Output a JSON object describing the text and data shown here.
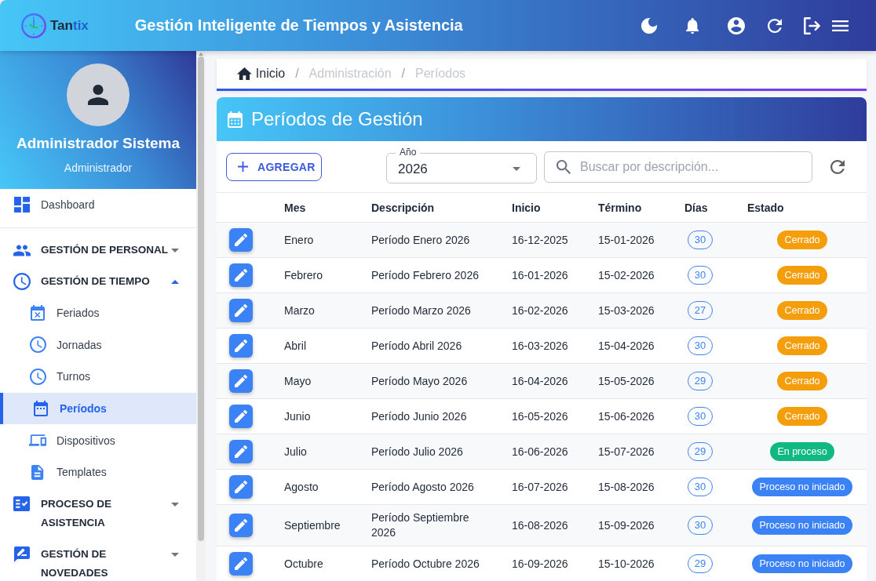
{
  "header": {
    "logo": {
      "lead": "Tan",
      "accent": "tix"
    },
    "title": "Gestión Inteligente de Tiempos y Asistencia"
  },
  "sidebar": {
    "user": {
      "name": "Administrador Sistema",
      "role": "Administrador"
    },
    "items": [
      {
        "kind": "link",
        "label": "Dashboard",
        "selected": false
      },
      {
        "kind": "group",
        "label": "GESTIÓN DE PERSONAL",
        "selected": false,
        "expanded": false
      },
      {
        "kind": "group",
        "label": "GESTIÓN DE TIEMPO",
        "selected": false,
        "expanded": true,
        "children": [
          {
            "label": "Feriados",
            "selected": false
          },
          {
            "label": "Jornadas",
            "selected": false
          },
          {
            "label": "Turnos",
            "selected": false
          },
          {
            "label": "Períodos",
            "selected": true
          },
          {
            "label": "Dispositivos",
            "selected": false
          },
          {
            "label": "Templates",
            "selected": false
          }
        ]
      },
      {
        "kind": "group",
        "label": "PROCESO DE ASISTENCIA",
        "selected": false,
        "expanded": false
      },
      {
        "kind": "group",
        "label": "GESTIÓN DE NOVEDADES",
        "selected": false,
        "expanded": false
      }
    ]
  },
  "breadcrumb": [
    {
      "label": "Inicio",
      "disabled": false
    },
    {
      "separator": "/",
      "label": "Administración",
      "disabled": true
    },
    {
      "separator": "/",
      "label": "Períodos",
      "disabled": true
    }
  ],
  "panel": {
    "title": "Períodos de Gestión",
    "add_button": "AGREGAR",
    "year_field": {
      "label": "Año",
      "value": "2026"
    },
    "search": {
      "placeholder": "Buscar por descripción..."
    },
    "table": {
      "columns": [
        "Mes",
        "Descripción",
        "Inicio",
        "Término",
        "Días",
        "Estado"
      ],
      "rows": [
        {
          "mes": "Enero",
          "descripcion": "Período Enero 2026",
          "inicio": "16-12-2025",
          "termino": "15-01-2026",
          "dias": "30",
          "estado": "Cerrado",
          "color": "#f59e0b"
        },
        {
          "mes": "Febrero",
          "descripcion": "Período Febrero 2026",
          "inicio": "16-01-2026",
          "termino": "15-02-2026",
          "dias": "30",
          "estado": "Cerrado",
          "color": "#f59e0b"
        },
        {
          "mes": "Marzo",
          "descripcion": "Período Marzo 2026",
          "inicio": "16-02-2026",
          "termino": "15-03-2026",
          "dias": "27",
          "estado": "Cerrado",
          "color": "#f59e0b"
        },
        {
          "mes": "Abril",
          "descripcion": "Período Abril 2026",
          "inicio": "16-03-2026",
          "termino": "15-04-2026",
          "dias": "30",
          "estado": "Cerrado",
          "color": "#f59e0b"
        },
        {
          "mes": "Mayo",
          "descripcion": "Período Mayo 2026",
          "inicio": "16-04-2026",
          "termino": "15-05-2026",
          "dias": "29",
          "estado": "Cerrado",
          "color": "#f59e0b"
        },
        {
          "mes": "Junio",
          "descripcion": "Período Junio 2026",
          "inicio": "16-05-2026",
          "termino": "15-06-2026",
          "dias": "30",
          "estado": "Cerrado",
          "color": "#f59e0b"
        },
        {
          "mes": "Julio",
          "descripcion": "Período Julio 2026",
          "inicio": "16-06-2026",
          "termino": "15-07-2026",
          "dias": "29",
          "estado": "En proceso",
          "color": "#10b981"
        },
        {
          "mes": "Agosto",
          "descripcion": "Período Agosto 2026",
          "inicio": "16-07-2026",
          "termino": "15-08-2026",
          "dias": "30",
          "estado": "Proceso no iniciado",
          "color": "#3b82f6"
        },
        {
          "mes": "Septiembre",
          "descripcion": "Período Septiembre 2026",
          "inicio": "16-08-2026",
          "termino": "15-09-2026",
          "dias": "30",
          "estado": "Proceso no iniciado",
          "color": "#3b82f6"
        },
        {
          "mes": "Octubre",
          "descripcion": "Período Octubre 2026",
          "inicio": "16-09-2026",
          "termino": "15-10-2026",
          "dias": "29",
          "estado": "Proceso no iniciado",
          "color": "#3b82f6"
        }
      ]
    }
  }
}
